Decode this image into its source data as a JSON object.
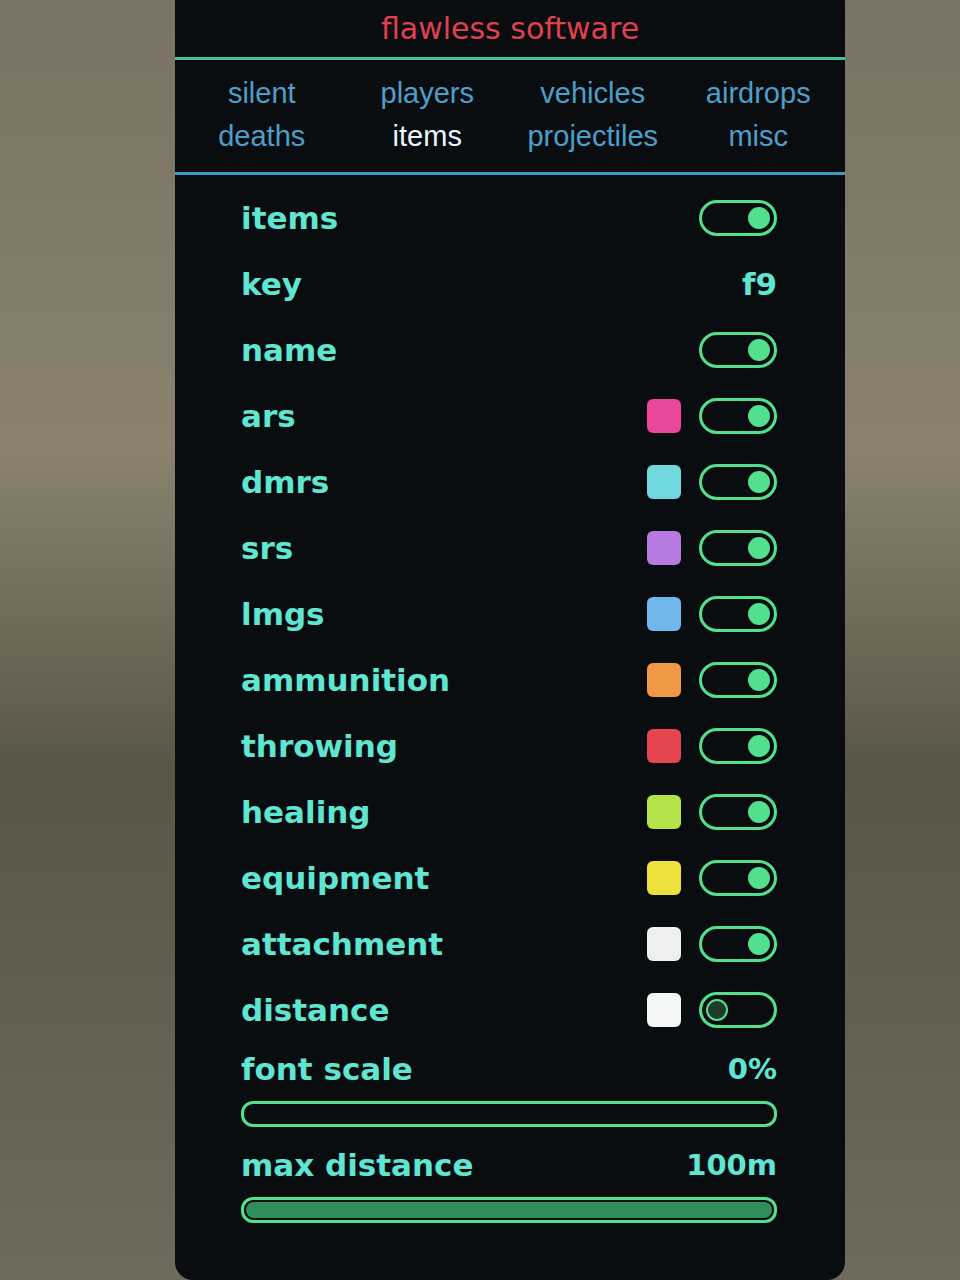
{
  "window": {
    "title": "flawless software"
  },
  "tabs": [
    {
      "label": "silent",
      "selected": false
    },
    {
      "label": "players",
      "selected": false
    },
    {
      "label": "vehicles",
      "selected": false
    },
    {
      "label": "airdrops",
      "selected": false
    },
    {
      "label": "deaths",
      "selected": false
    },
    {
      "label": "items",
      "selected": true
    },
    {
      "label": "projectiles",
      "selected": false
    },
    {
      "label": "misc",
      "selected": false
    }
  ],
  "settings": [
    {
      "kind": "toggle",
      "label": "items",
      "on": true
    },
    {
      "kind": "key",
      "label": "key",
      "value": "f9"
    },
    {
      "kind": "toggle",
      "label": "name",
      "on": true
    },
    {
      "kind": "color-toggle",
      "label": "ars",
      "color": "#e8479a",
      "on": true
    },
    {
      "kind": "color-toggle",
      "label": "dmrs",
      "color": "#6fd8de",
      "on": true
    },
    {
      "kind": "color-toggle",
      "label": "srs",
      "color": "#b77ae0",
      "on": true
    },
    {
      "kind": "color-toggle",
      "label": "lmgs",
      "color": "#6fb6ea",
      "on": true
    },
    {
      "kind": "color-toggle",
      "label": "ammunition",
      "color": "#ee9a45",
      "on": true
    },
    {
      "kind": "color-toggle",
      "label": "throwing",
      "color": "#e6464f",
      "on": true
    },
    {
      "kind": "color-toggle",
      "label": "healing",
      "color": "#b5e44a",
      "on": true
    },
    {
      "kind": "color-toggle",
      "label": "equipment",
      "color": "#ece03c",
      "on": true
    },
    {
      "kind": "color-toggle",
      "label": "attachment",
      "color": "#eef0f0",
      "on": true
    },
    {
      "kind": "color-toggle",
      "label": "distance",
      "color": "#f4f6f6",
      "on": false
    }
  ],
  "sliders": [
    {
      "label": "font scale",
      "reading": "0%",
      "level": 0
    },
    {
      "label": "max distance",
      "reading": "100m",
      "level": 1
    }
  ]
}
